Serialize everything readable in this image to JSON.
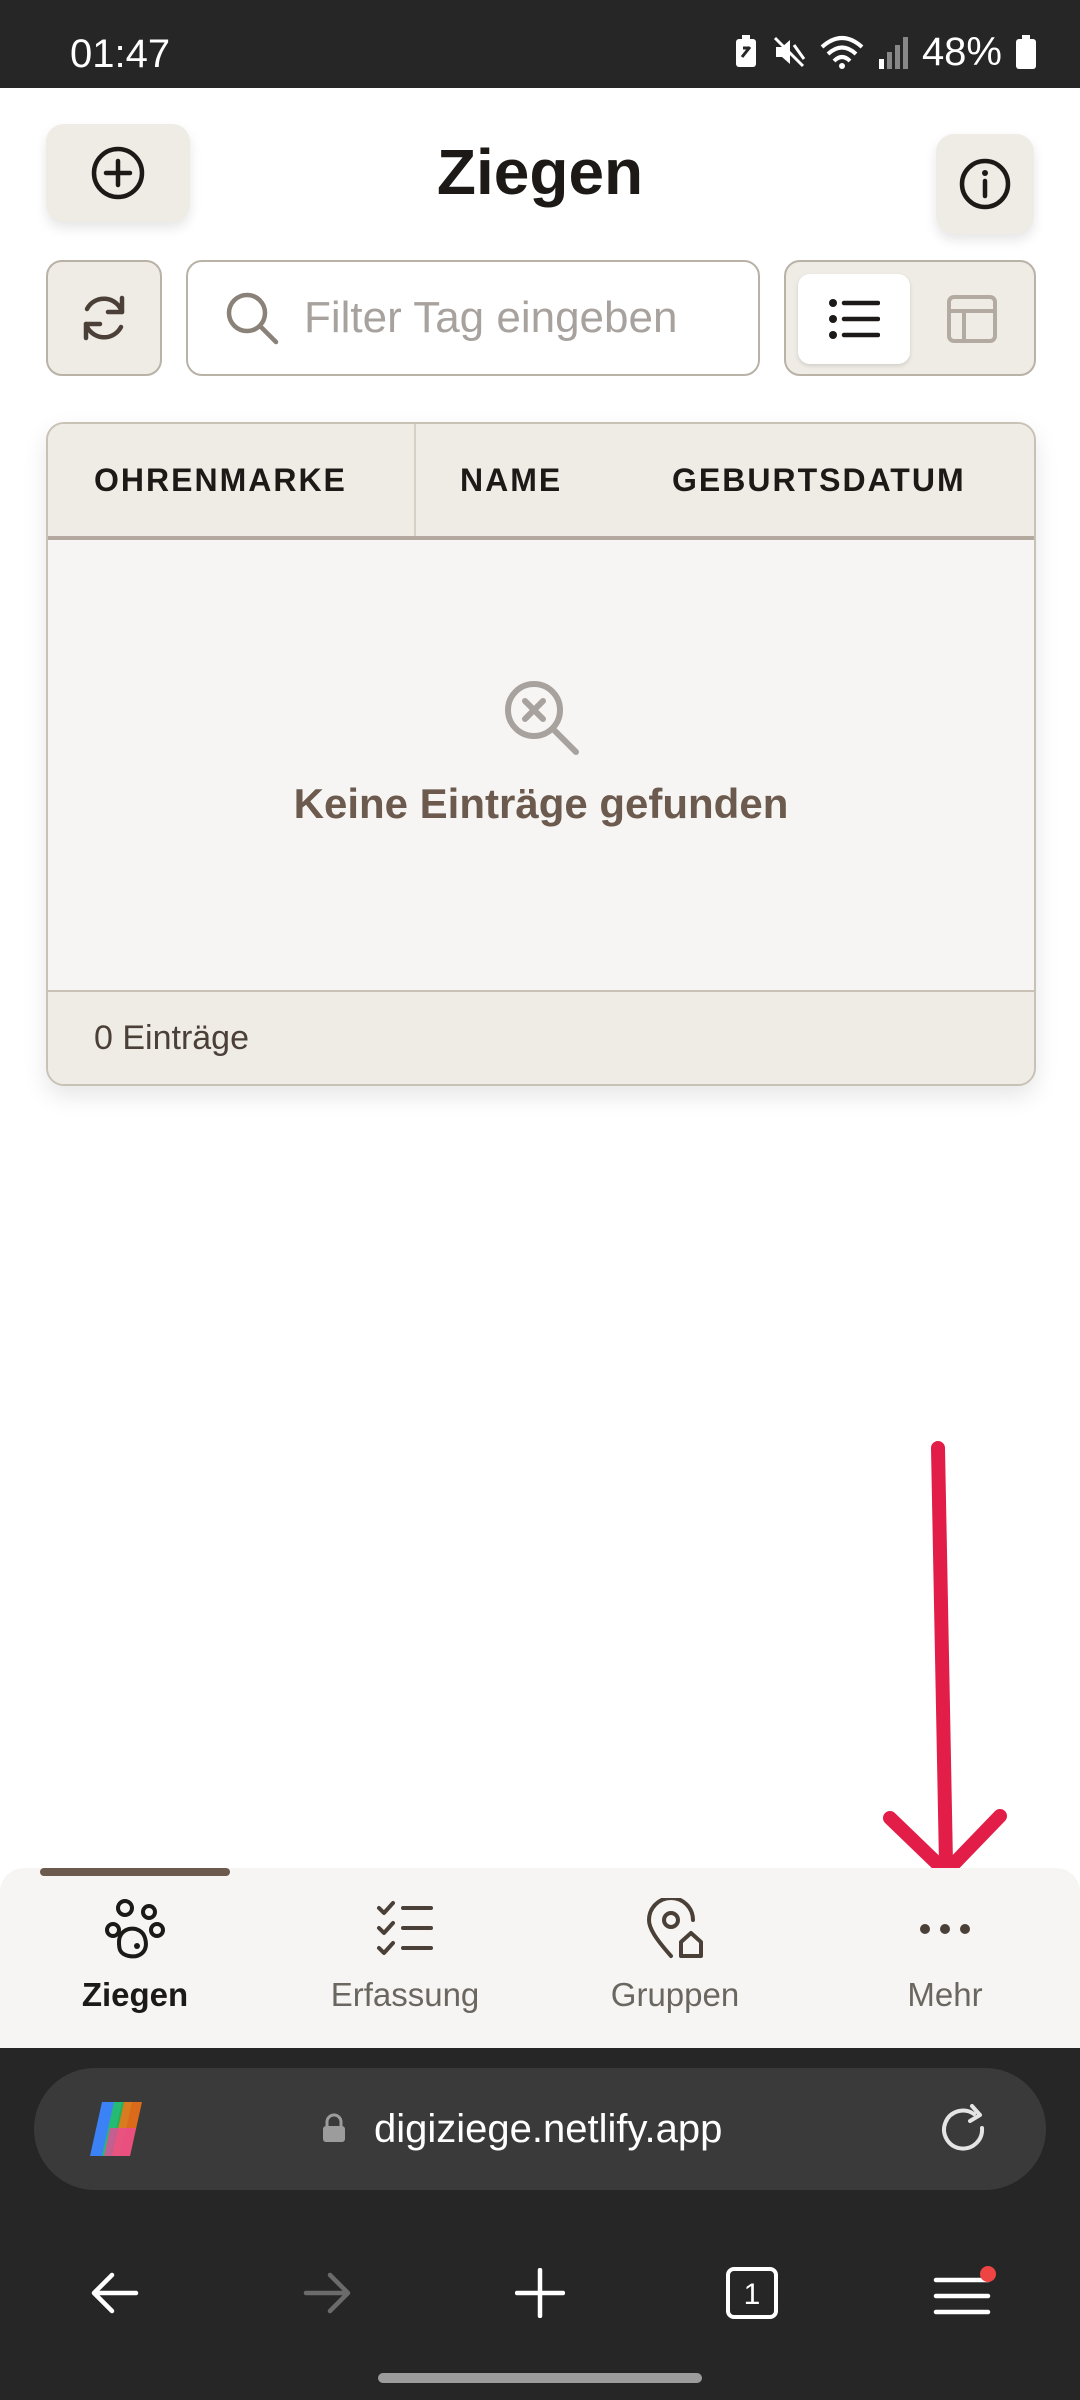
{
  "status_bar": {
    "time": "01:47",
    "battery": "48%",
    "icons": [
      "battery-saver-icon",
      "mute-icon",
      "wifi-icon",
      "signal-icon",
      "battery-icon"
    ]
  },
  "header": {
    "title": "Ziegen",
    "add_icon": "plus-circle-icon",
    "info_icon": "info-icon"
  },
  "toolbar": {
    "refresh_icon": "refresh-icon",
    "search_placeholder": "Filter Tag eingeben",
    "search_value": "",
    "view_modes": [
      {
        "name": "list",
        "icon": "list-icon",
        "selected": true
      },
      {
        "name": "table",
        "icon": "table-icon",
        "selected": false
      }
    ]
  },
  "table": {
    "columns": [
      "OHRENMARKE",
      "NAME",
      "GEBURTSDATUM"
    ],
    "rows": [],
    "empty_text": "Keine Einträge gefunden",
    "footer_count": "0 Einträge"
  },
  "bottom_nav": {
    "items": [
      {
        "label": "Ziegen",
        "icon": "goat-icon",
        "active": true
      },
      {
        "label": "Erfassung",
        "icon": "checklist-icon",
        "active": false
      },
      {
        "label": "Gruppen",
        "icon": "location-home-icon",
        "active": false
      },
      {
        "label": "Mehr",
        "icon": "more-icon",
        "active": false
      }
    ]
  },
  "browser": {
    "url": "digiziege.netlify.app",
    "tab_count": "1"
  },
  "colors": {
    "accent": "#6b5a4d",
    "annotation_arrow": "#e11d48",
    "button_bg": "#efebe5",
    "dark_chrome": "#262626"
  }
}
